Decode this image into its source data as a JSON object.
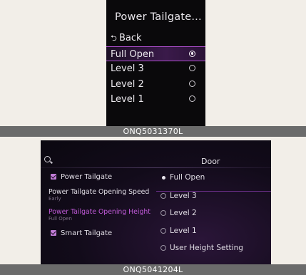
{
  "top": {
    "title": "Power Tailgate...",
    "back_label": "Back",
    "options": [
      {
        "label": "Full Open",
        "selected": true
      },
      {
        "label": "Level 3",
        "selected": false
      },
      {
        "label": "Level 2",
        "selected": false
      },
      {
        "label": "Level 1",
        "selected": false
      }
    ],
    "caption": "ONQ5031370L"
  },
  "bottom": {
    "title": "Door",
    "left_items": {
      "power_tailgate": "Power Tailgate",
      "opening_speed": "Power Tailgate Opening Speed",
      "opening_speed_value": "Early",
      "opening_height": "Power Tailgate Opening Height",
      "opening_height_value": "Full Open",
      "smart_tailgate": "Smart Tailgate"
    },
    "right_options": [
      {
        "label": "Full Open",
        "selected": true
      },
      {
        "label": "Level 3",
        "selected": false
      },
      {
        "label": "Level 2",
        "selected": false
      },
      {
        "label": "Level 1",
        "selected": false
      },
      {
        "label": "User Height Setting",
        "selected": false
      }
    ],
    "caption": "ONQ5041204L"
  },
  "colors": {
    "accent_purple": "#b04fd0",
    "highlight_text": "#c05ad8",
    "caption_bg": "#6b6b6b"
  },
  "icons": {
    "back": "return-arrow-icon",
    "search": "search-icon",
    "checkbox": "checkbox-checked-icon"
  }
}
